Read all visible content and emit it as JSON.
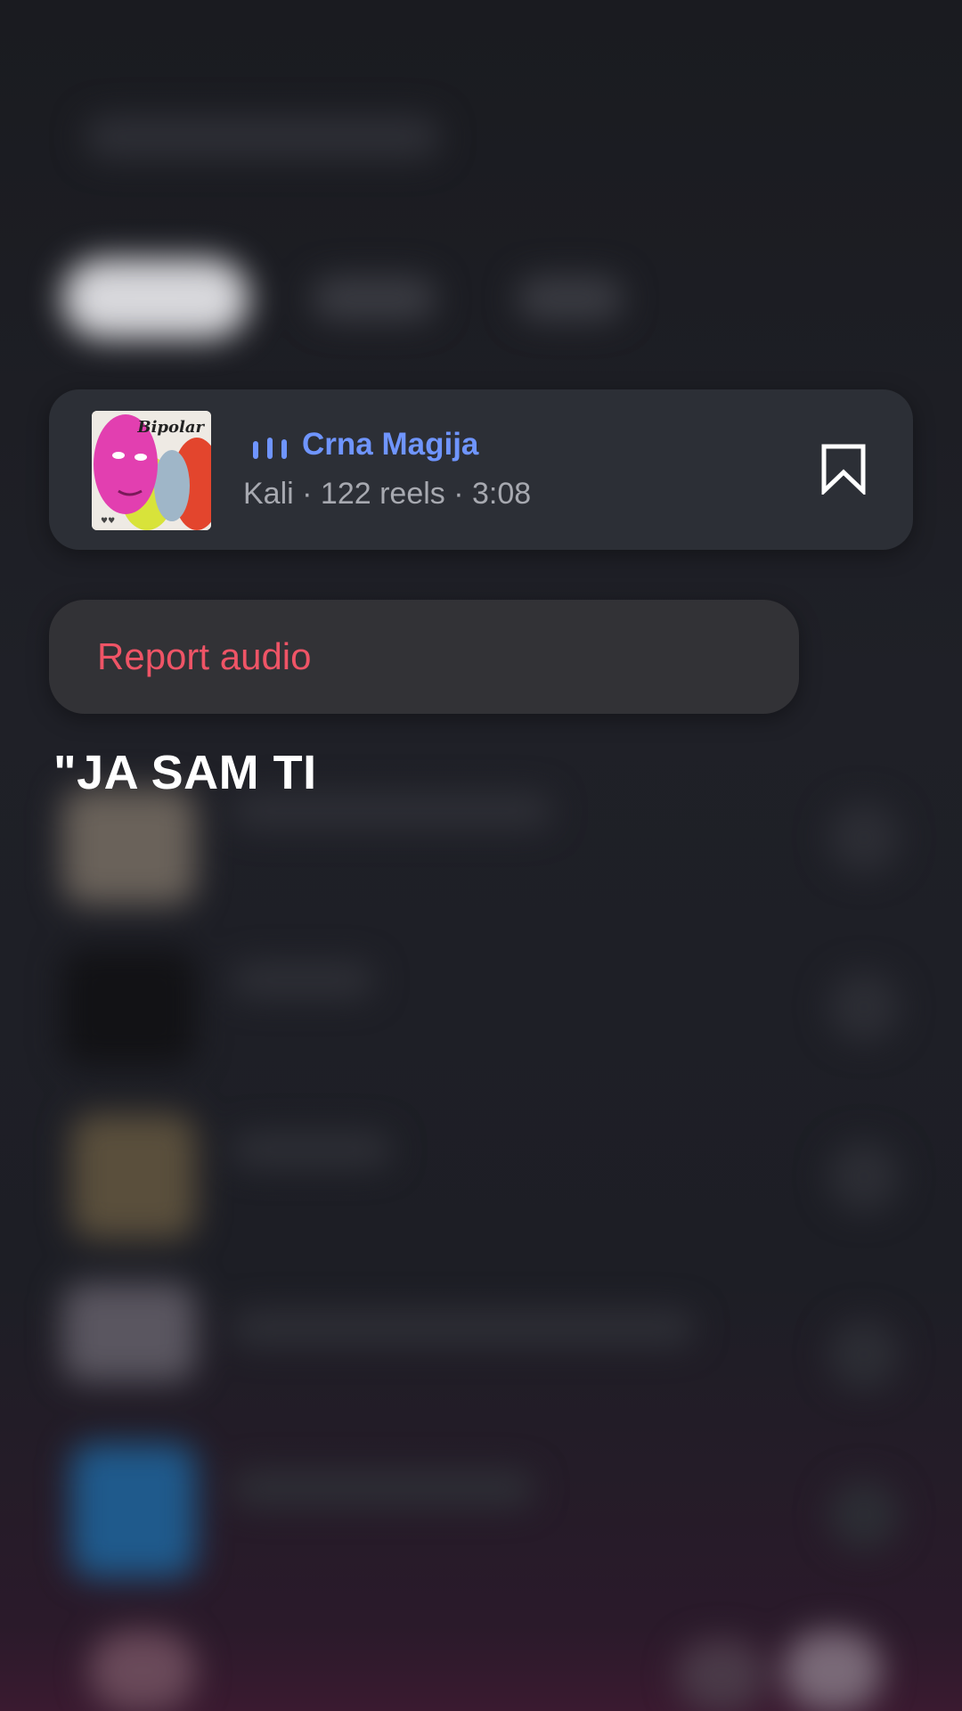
{
  "audio_card": {
    "cover_title": "Bipolar",
    "title": "Crna Magija",
    "meta": "Kali · 122 reels · 3:08",
    "icons": [
      "equalizer-icon",
      "bookmark-icon"
    ],
    "accent_color": "#6f95ff"
  },
  "menu": {
    "report_label": "Report audio",
    "report_color": "#ef5466"
  },
  "caption": "\"JA SAM TI"
}
